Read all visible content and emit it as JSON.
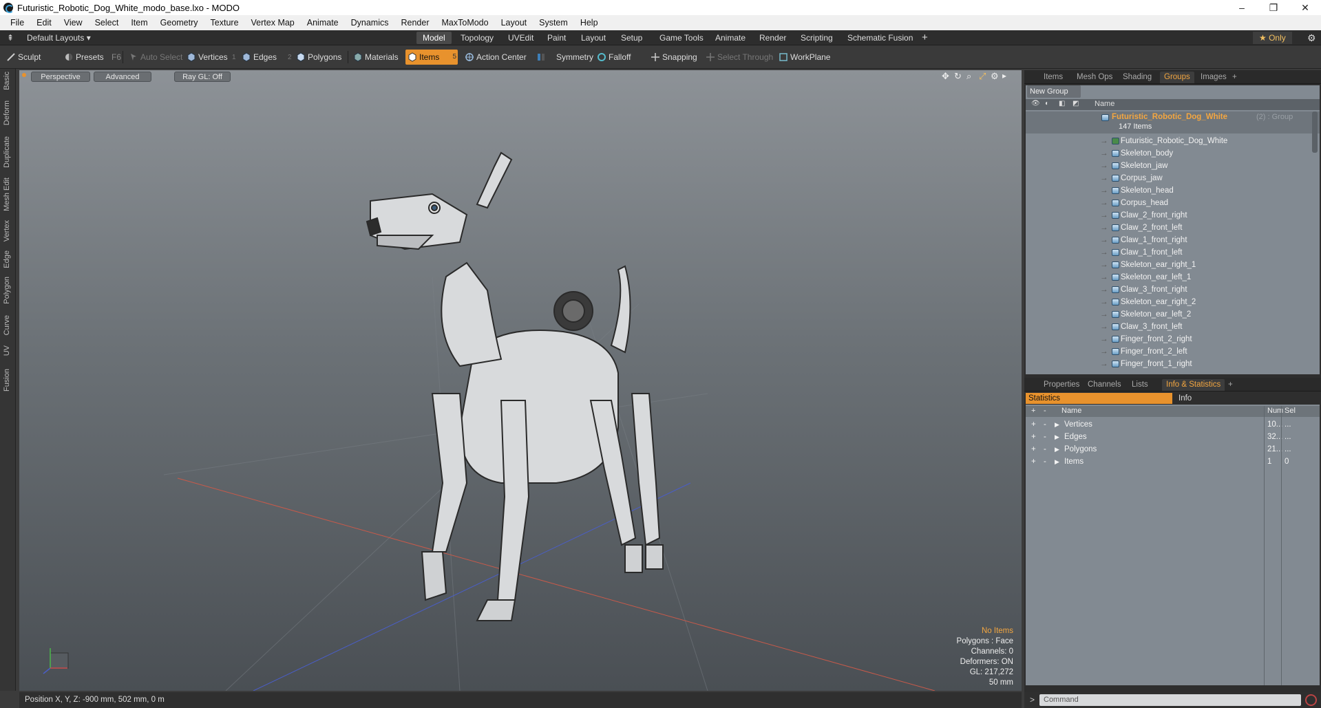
{
  "window": {
    "title": "Futuristic_Robotic_Dog_White_modo_base.lxo - MODO",
    "min": "–",
    "max": "❐",
    "close": "✕"
  },
  "menu": [
    "File",
    "Edit",
    "View",
    "Select",
    "Item",
    "Geometry",
    "Texture",
    "Vertex Map",
    "Animate",
    "Dynamics",
    "Render",
    "MaxToModo",
    "Layout",
    "System",
    "Help"
  ],
  "layout": {
    "preset": "Default Layouts ▾",
    "tabs": [
      "Model",
      "Topology",
      "UVEdit",
      "Paint",
      "Layout",
      "Setup",
      "Game Tools",
      "Animate",
      "Render",
      "Scripting",
      "Schematic Fusion"
    ],
    "active_tab": "Model",
    "add": "+",
    "only": "★  Only"
  },
  "toolbar": {
    "sculpt": "Sculpt",
    "presets": "Presets",
    "presets_key": "F6",
    "auto_select": "Auto Select",
    "vertices": "Vertices",
    "vertices_count": "1",
    "edges": "Edges",
    "edges_count": "2",
    "polygons": "Polygons",
    "materials": "Materials",
    "items": "Items",
    "items_count": "5",
    "action_center": "Action Center",
    "symmetry": "Symmetry",
    "falloff": "Falloff",
    "snapping": "Snapping",
    "select_through": "Select Through",
    "workplane": "WorkPlane"
  },
  "side_tabs": [
    "Basic",
    "Deform",
    "Duplicate",
    "Mesh Edit",
    "Vertex",
    "Edge",
    "Polygon",
    "Curve",
    "UV",
    "Fusion"
  ],
  "viewport": {
    "view": "Perspective",
    "shading": "Advanced",
    "raygl": "Ray GL: Off",
    "overlay": {
      "selection": "No Items",
      "polygons": "Polygons : Face",
      "channels": "Channels: 0",
      "deformers": "Deformers: ON",
      "gl": "GL: 217,272",
      "scale": "50 mm"
    }
  },
  "status": {
    "position": "Position X, Y, Z:  -900 mm, 502 mm, 0 m"
  },
  "groups_panel": {
    "tabs": [
      "Items",
      "Mesh Ops",
      "Shading",
      "Groups",
      "Images"
    ],
    "active_tab": "Groups",
    "new_group": "New Group",
    "column_name": "Name",
    "group": {
      "name": "Futuristic_Robotic_Dog_White",
      "suffix": "(2) : Group",
      "count": "147 Items"
    },
    "items": [
      "Futuristic_Robotic_Dog_White",
      "Skeleton_body",
      "Skeleton_jaw",
      "Corpus_jaw",
      "Skeleton_head",
      "Corpus_head",
      "Claw_2_front_right",
      "Claw_2_front_left",
      "Claw_1_front_right",
      "Claw_1_front_left",
      "Skeleton_ear_right_1",
      "Skeleton_ear_left_1",
      "Claw_3_front_right",
      "Skeleton_ear_right_2",
      "Skeleton_ear_left_2",
      "Claw_3_front_left",
      "Finger_front_2_right",
      "Finger_front_2_left",
      "Finger_front_1_right"
    ]
  },
  "props_panel": {
    "tabs": [
      "Properties",
      "Channels",
      "Lists",
      "Info & Statistics"
    ],
    "active_tab": "Info & Statistics",
    "subtabs": [
      "Statistics",
      "Info"
    ],
    "columns": {
      "name": "Name",
      "num": "Num",
      "sel": "Sel"
    },
    "rows": [
      {
        "name": "Vertices",
        "num": "10...",
        "sel": "..."
      },
      {
        "name": "Edges",
        "num": "32...",
        "sel": "..."
      },
      {
        "name": "Polygons",
        "num": "21...",
        "sel": "..."
      },
      {
        "name": "Items",
        "num": "1",
        "sel": "0"
      }
    ]
  },
  "command": {
    "placeholder": "Command",
    "prompt": ">"
  }
}
